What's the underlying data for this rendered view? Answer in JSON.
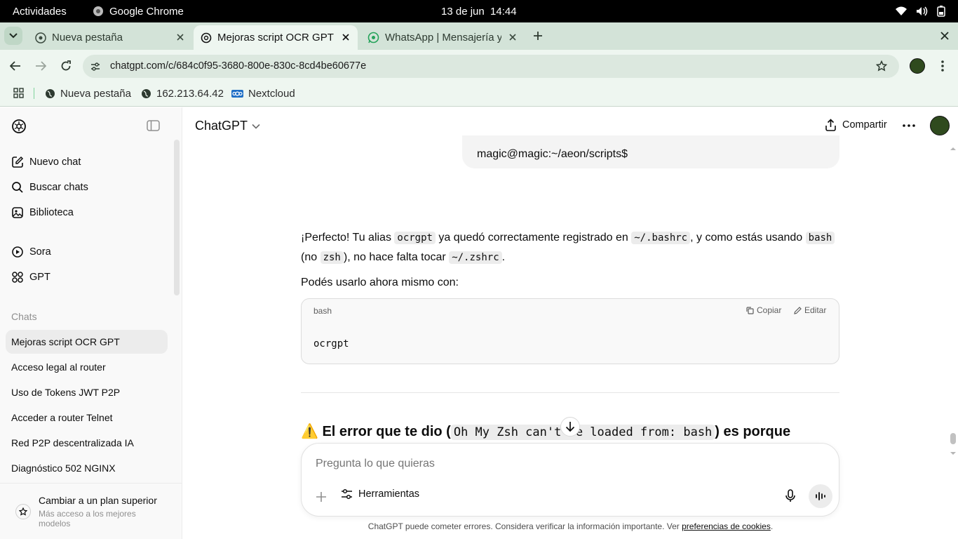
{
  "system_bar": {
    "activities": "Actividades",
    "app_name": "Google Chrome",
    "datetime": "13 de jun  14:44"
  },
  "browser": {
    "tabs": [
      {
        "title": "Nueva pestaña",
        "icon": "chrome-icon"
      },
      {
        "title": "Mejoras script OCR GPT",
        "icon": "openai-icon"
      },
      {
        "title": "WhatsApp | Mensajería y",
        "icon": "whatsapp-icon"
      }
    ],
    "url": "chatgpt.com/c/684c0f95-3680-800e-830c-8cd4be60677e",
    "bookmarks": [
      {
        "label": "Nueva pestaña",
        "icon": "globe-icon"
      },
      {
        "label": "162.213.64.42",
        "icon": "globe-icon"
      },
      {
        "label": "Nextcloud",
        "icon": "nextcloud-icon"
      }
    ]
  },
  "sidebar": {
    "nav": [
      {
        "label": "Nuevo chat",
        "icon": "new-chat-icon"
      },
      {
        "label": "Buscar chats",
        "icon": "search-icon"
      },
      {
        "label": "Biblioteca",
        "icon": "library-icon"
      },
      {
        "label": "Sora",
        "icon": "sora-icon"
      },
      {
        "label": "GPT",
        "icon": "grid-icon"
      }
    ],
    "section_title": "Chats",
    "chats": [
      "Mejoras script OCR GPT",
      "Acceso legal al router",
      "Uso de Tokens JWT P2P",
      "Acceder a router Telnet",
      "Red P2P descentralizada IA",
      "Diagnóstico 502 NGINX"
    ],
    "upgrade": {
      "title": "Cambiar a un plan superior",
      "subtitle": "Más acceso a los mejores modelos"
    }
  },
  "header": {
    "model": "ChatGPT",
    "share": "Compartir"
  },
  "conversation": {
    "user_bubble_tail": "magic@magic:~/aeon/scripts$",
    "p1": {
      "t1": "¡Perfecto! Tu alias ",
      "c1": "ocrgpt",
      "t2": " ya quedó correctamente registrado en ",
      "c2": "~/.bashrc",
      "t3": ", y como estás usando ",
      "c3": "bash",
      "t4": "(no ",
      "c4": "zsh",
      "t5": "), no hace falta tocar ",
      "c5": "~/.zshrc",
      "t6": "."
    },
    "p2": "Podés usarlo ahora mismo con:",
    "code_block": {
      "language": "bash",
      "copy": "Copiar",
      "edit": "Editar",
      "code": "ocrgpt"
    },
    "heading": {
      "emoji": "⚠️",
      "t1": "El error que te dio (",
      "code": "Oh My Zsh can't be loaded from: bash",
      "t2": ") es porque"
    }
  },
  "composer": {
    "placeholder": "Pregunta lo que quieras",
    "tools": "Herramientas"
  },
  "footer": {
    "text": "ChatGPT puede cometer errores. Considera verificar la información importante. Ver ",
    "link": "preferencias de cookies",
    "end": "."
  }
}
